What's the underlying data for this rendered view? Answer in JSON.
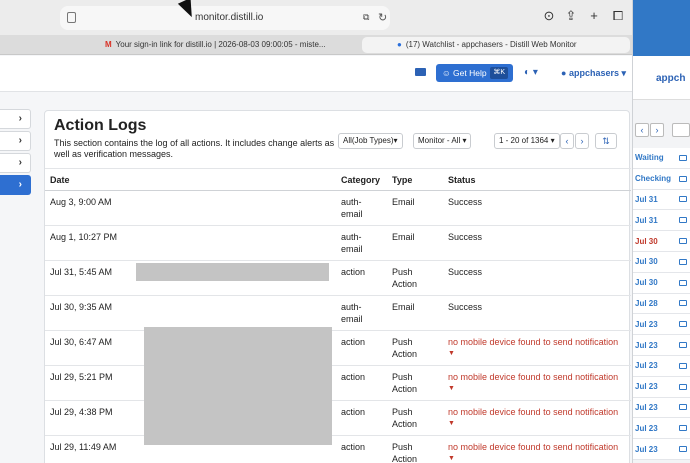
{
  "browser": {
    "url": "monitor.distill.io",
    "tabs": [
      {
        "label": "Your sign-in link for distill.io | 2026-08-03 09:00:05 - miste..."
      },
      {
        "label": "(17) Watchlist - appchasers - Distill Web Monitor"
      }
    ]
  },
  "header": {
    "help_label": "Get Help",
    "help_shortcut": "⌘K",
    "user_label": "appchasers ▾"
  },
  "sidebar": {
    "items": [
      {
        "icon": "chevron-right"
      },
      {
        "icon": "chevron-right"
      },
      {
        "icon": "chevron-right"
      },
      {
        "icon": "chevron-right",
        "active": true
      }
    ]
  },
  "panel": {
    "title": "Action Logs",
    "description": "This section contains the log of all actions. It includes change alerts as well as verification messages.",
    "filter_type": "All(Job Types)▾",
    "filter_monitor": "Monitor - All ▾",
    "pager": "1 - 20 of 1364 ▾",
    "sort_icon": "sort-icon"
  },
  "table": {
    "headers": [
      "Date",
      "Category",
      "Type",
      "Status"
    ],
    "rows": [
      {
        "date": "Aug 3, 9:00 AM",
        "category": "auth-email",
        "type": "Email",
        "status": "Success"
      },
      {
        "date": "Aug 1, 10:27 PM",
        "category": "auth-email",
        "type": "Email",
        "status": "Success"
      },
      {
        "date": "Jul 31, 5:45 AM",
        "category": "action",
        "type": "Push Action",
        "status": "Success"
      },
      {
        "date": "Jul 30, 9:35 AM",
        "category": "auth-email",
        "type": "Email",
        "status": "Success"
      },
      {
        "date": "Jul 30, 6:47 AM",
        "category": "action",
        "type": "Push Action",
        "status": "no mobile device found to send notification"
      },
      {
        "date": "Jul 29, 5:21 PM",
        "category": "action",
        "type": "Push Action",
        "status": "no mobile device found to send notification"
      },
      {
        "date": "Jul 29, 4:38 PM",
        "category": "action",
        "type": "Push Action",
        "status": "no mobile device found to send notification"
      },
      {
        "date": "Jul 29, 11:49 AM",
        "category": "action",
        "type": "Push Action",
        "status": "no mobile device found to send notification"
      }
    ]
  },
  "background_window": {
    "user_label": "appch",
    "rows": [
      "Waiting",
      "Checking",
      "Jul 31",
      "Jul 31",
      "Jul 30",
      "Jul 30",
      "Jul 30",
      "Jul 28",
      "Jul 23",
      "Jul 23",
      "Jul 23",
      "Jul 23",
      "Jul 23",
      "Jul 23",
      "Jul 23"
    ]
  },
  "colors": {
    "accent": "#2e6fd1",
    "error": "#c0392b",
    "redaction": "#c4c4c4"
  }
}
